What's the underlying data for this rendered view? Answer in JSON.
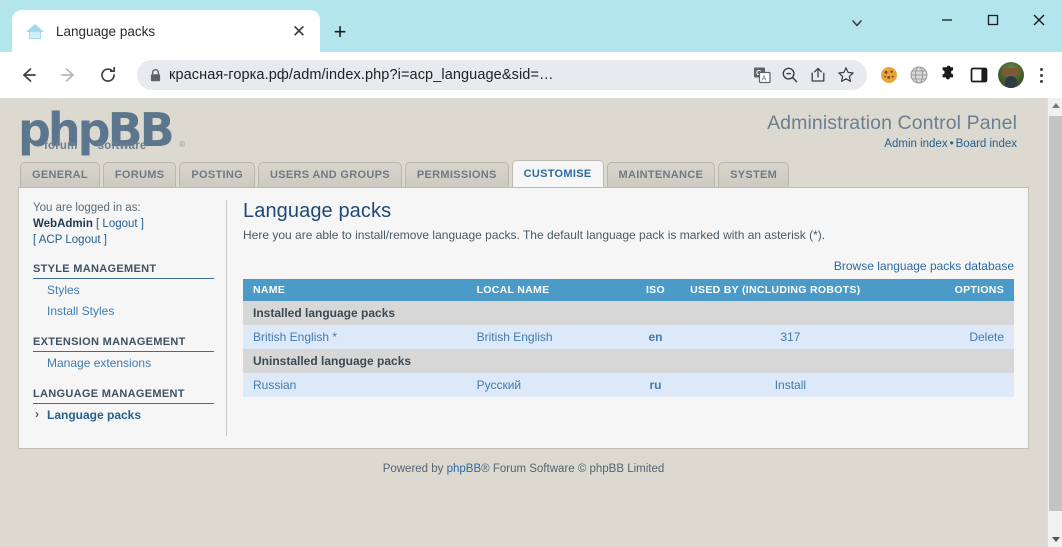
{
  "browser": {
    "tab": {
      "title": "Language packs",
      "favicon": "house-icon",
      "close": "✕"
    },
    "new_tab": "+",
    "url": "красная-горка.рф/adm/index.php?i=acp_language&sid=…",
    "omnibox_icons": [
      "translate-icon",
      "zoom-out-icon",
      "share-icon",
      "bookmark-star-icon"
    ],
    "extension_icons": [
      "cookie-icon",
      "globe-icon",
      "puzzle-icon",
      "side-panel-icon"
    ],
    "nav": {
      "back": "back-icon",
      "forward": "forward-icon",
      "reload": "reload-icon"
    },
    "window": {
      "tab_search": "chevron-down-icon",
      "minimize": "—",
      "maximize": "□",
      "close": "✕"
    }
  },
  "acp": {
    "logo_text": "phpBB",
    "logo_sub_left": "forum",
    "logo_sub_right": "software",
    "logo_reg": "®",
    "header_title": "Administration Control Panel",
    "header_links": {
      "admin_index": "Admin index",
      "separator": "•",
      "board_index": "Board index"
    },
    "tabs": [
      {
        "label": "GENERAL",
        "active": false
      },
      {
        "label": "FORUMS",
        "active": false
      },
      {
        "label": "POSTING",
        "active": false
      },
      {
        "label": "USERS AND GROUPS",
        "active": false
      },
      {
        "label": "PERMISSIONS",
        "active": false
      },
      {
        "label": "CUSTOMISE",
        "active": true
      },
      {
        "label": "MAINTENANCE",
        "active": false
      },
      {
        "label": "SYSTEM",
        "active": false
      }
    ],
    "sidebar": {
      "logged_in_label": "You are logged in as:",
      "username": "WebAdmin",
      "logout": "[ Logout ]",
      "acp_logout": "[ ACP Logout ]",
      "sections": [
        {
          "heading": "STYLE MANAGEMENT",
          "links": [
            {
              "label": "Styles",
              "active": false
            },
            {
              "label": "Install Styles",
              "active": false
            }
          ]
        },
        {
          "heading": "EXTENSION MANAGEMENT",
          "links": [
            {
              "label": "Manage extensions",
              "active": false
            }
          ]
        },
        {
          "heading": "LANGUAGE MANAGEMENT",
          "links": [
            {
              "label": "Language packs",
              "active": true
            }
          ]
        }
      ]
    },
    "page": {
      "title": "Language packs",
      "description": "Here you are able to install/remove language packs. The default language pack is marked with an asterisk (*).",
      "browse_link": "Browse language packs database",
      "table": {
        "headers": {
          "name": "NAME",
          "local_name": "LOCAL NAME",
          "iso": "ISO",
          "used_by": "USED BY (INCLUDING ROBOTS)",
          "options": "OPTIONS"
        },
        "groups": [
          {
            "group_label": "Installed language packs",
            "rows": [
              {
                "name": "British English *",
                "local_name": "British English",
                "iso": "en",
                "used_by": "317",
                "option": "Delete",
                "option_column": "options"
              }
            ]
          },
          {
            "group_label": "Uninstalled language packs",
            "rows": [
              {
                "name": "Russian",
                "local_name": "Русский",
                "iso": "ru",
                "used_by": "Install",
                "option": "",
                "option_column": "used_by"
              }
            ]
          }
        ]
      }
    },
    "footer": {
      "prefix": "Powered by ",
      "brand": "phpBB",
      "suffix": "® Forum Software © phpBB Limited"
    }
  },
  "colors": {
    "chrome_accent": "#b3e5ed",
    "page_bg": "#dcd9d0",
    "table_header": "#4b9ac7",
    "data_row": "#dde8f8",
    "group_row": "#d7d7d7",
    "link": "#3f7cb0",
    "active_tab_text": "#2b6aa3"
  }
}
